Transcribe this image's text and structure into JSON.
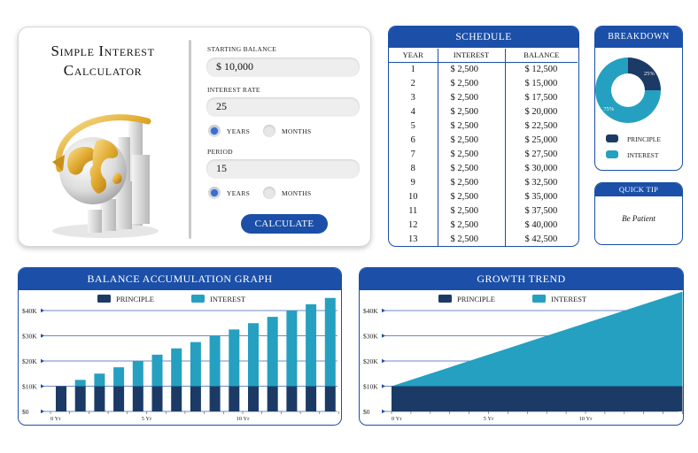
{
  "calculator": {
    "title_line1": "Simple Interest",
    "title_line2": "Calculator",
    "starting_balance_label": "STARTING BALANCE",
    "starting_balance_value": "$ 10,000",
    "interest_rate_label": "INTEREST RATE",
    "interest_rate_value": "25",
    "rate_unit_years": "YEARS",
    "rate_unit_months": "MONTHS",
    "rate_unit_selected": "YEARS",
    "period_label": "PERIOD",
    "period_value": "15",
    "period_unit_years": "YEARS",
    "period_unit_months": "MONTHS",
    "period_unit_selected": "YEARS",
    "calculate_label": "CALCULATE"
  },
  "schedule": {
    "title": "SCHEDULE",
    "headers": [
      "YEAR",
      "INTEREST",
      "BALANCE"
    ],
    "rows": [
      [
        "1",
        "$ 2,500",
        "$ 12,500"
      ],
      [
        "2",
        "$ 2,500",
        "$ 15,000"
      ],
      [
        "3",
        "$ 2,500",
        "$ 17,500"
      ],
      [
        "4",
        "$ 2,500",
        "$ 20,000"
      ],
      [
        "5",
        "$ 2,500",
        "$ 22,500"
      ],
      [
        "6",
        "$ 2,500",
        "$ 25,000"
      ],
      [
        "7",
        "$ 2,500",
        "$ 27,500"
      ],
      [
        "8",
        "$ 2,500",
        "$ 30,000"
      ],
      [
        "9",
        "$ 2,500",
        "$ 32,500"
      ],
      [
        "10",
        "$ 2,500",
        "$ 35,000"
      ],
      [
        "11",
        "$ 2,500",
        "$ 37,500"
      ],
      [
        "12",
        "$ 2,500",
        "$ 40,000"
      ],
      [
        "13",
        "$ 2,500",
        "$ 42,500"
      ]
    ]
  },
  "breakdown": {
    "title": "BREAKDOWN",
    "principle_label": "PRINCIPLE",
    "interest_label": "INTEREST",
    "principle_pct": "25%",
    "interest_pct": "75%",
    "principle_share": 0.25,
    "interest_share": 0.75
  },
  "quick_tip": {
    "title": "QUICK TIP",
    "text": "Be Patient"
  },
  "colors": {
    "brand_blue": "#1b4fa8",
    "principle": "#1c3a66",
    "interest": "#25a0c0"
  },
  "chart_data": [
    {
      "type": "bar",
      "title": "BALANCE ACCUMULATION GRAPH",
      "stacked": true,
      "legend_position": "top",
      "x": [
        0,
        1,
        2,
        3,
        4,
        5,
        6,
        7,
        8,
        9,
        10,
        11,
        12,
        13,
        14,
        15
      ],
      "x_ticks": [
        {
          "x": 0,
          "label": "0 Yr"
        },
        {
          "x": 5,
          "label": "5 Yr"
        },
        {
          "x": 10,
          "label": "10 Yr"
        }
      ],
      "y_ticks": [
        "$0",
        "$10K",
        "$20K",
        "$30K",
        "$40K"
      ],
      "ylim": [
        0,
        40000
      ],
      "series": [
        {
          "name": "PRINCIPLE",
          "values": [
            10000,
            10000,
            10000,
            10000,
            10000,
            10000,
            10000,
            10000,
            10000,
            10000,
            10000,
            10000,
            10000,
            10000,
            10000,
            10000
          ]
        },
        {
          "name": "INTEREST",
          "values": [
            0,
            2500,
            5000,
            7500,
            10000,
            12500,
            15000,
            17500,
            20000,
            22500,
            25000,
            27500,
            30000,
            32500,
            35000,
            37500
          ]
        }
      ]
    },
    {
      "type": "area",
      "title": "GROWTH TREND",
      "stacked": true,
      "legend_position": "top",
      "x": [
        0,
        15
      ],
      "x_ticks": [
        {
          "x": 0,
          "label": "0 Yr"
        },
        {
          "x": 5,
          "label": "5 Yr"
        },
        {
          "x": 10,
          "label": "10 Yr"
        }
      ],
      "y_ticks": [
        "$0",
        "$10K",
        "$20K",
        "$30K",
        "$40K"
      ],
      "ylim": [
        0,
        40000
      ],
      "series": [
        {
          "name": "PRINCIPLE",
          "values": [
            10000,
            10000
          ]
        },
        {
          "name": "INTEREST",
          "values": [
            0,
            37500
          ]
        }
      ]
    }
  ]
}
